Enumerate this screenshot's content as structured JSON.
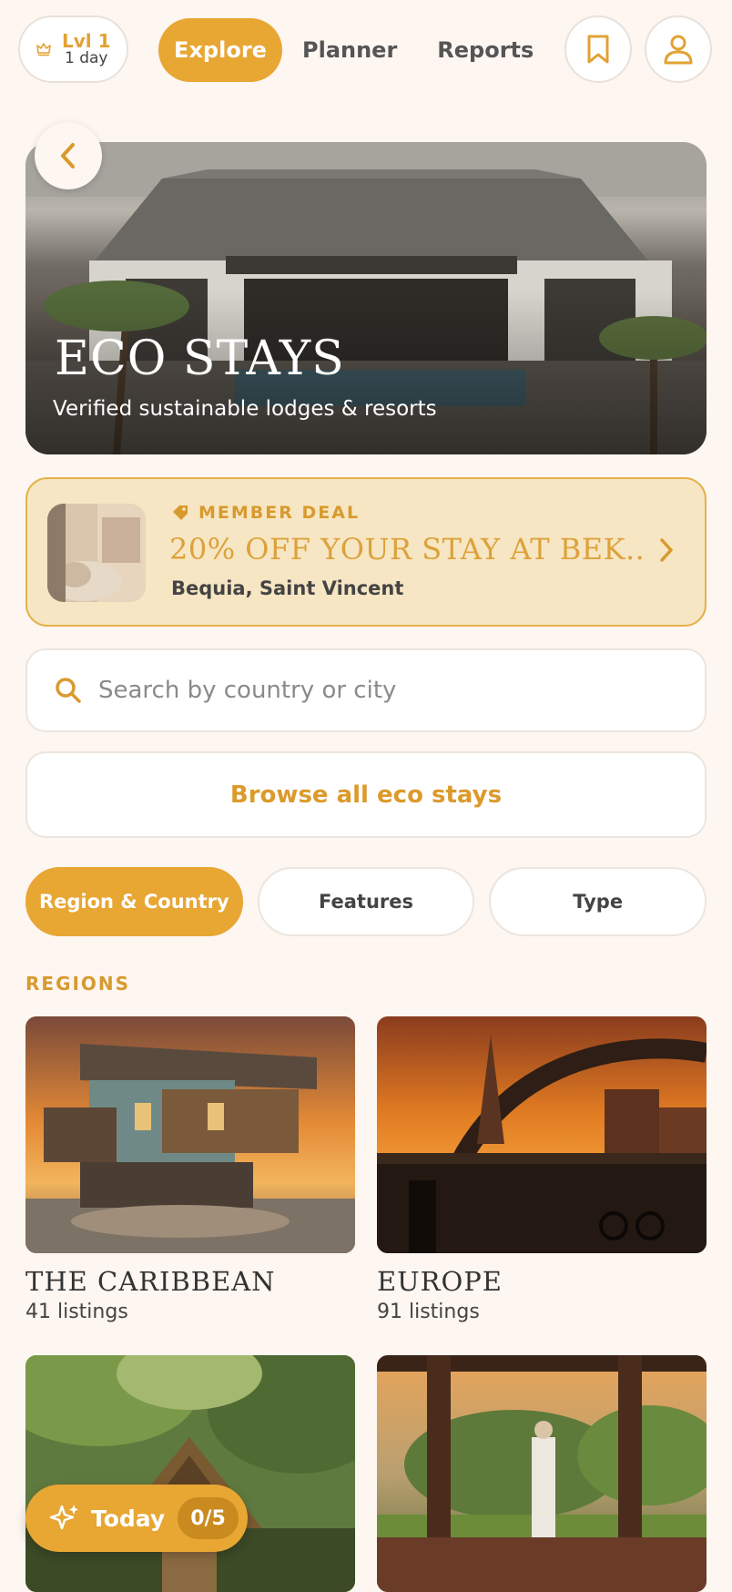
{
  "header": {
    "level": {
      "title": "Lvl 1",
      "subtitle": "1 day"
    },
    "tabs": [
      {
        "label": "Explore",
        "active": true
      },
      {
        "label": "Planner",
        "active": false
      },
      {
        "label": "Reports",
        "active": false
      }
    ]
  },
  "hero": {
    "title": "ECO STAYS",
    "subtitle": "Verified sustainable lodges & resorts"
  },
  "deal": {
    "label": "MEMBER DEAL",
    "title": "20% OFF YOUR STAY AT BEK...",
    "location": "Bequia, Saint Vincent"
  },
  "search": {
    "placeholder": "Search by country or city",
    "value": ""
  },
  "browse_label": "Browse all eco stays",
  "filters": [
    {
      "label": "Region & Country",
      "active": true
    },
    {
      "label": "Features",
      "active": false
    },
    {
      "label": "Type",
      "active": false
    }
  ],
  "regions": {
    "section_label": "REGIONS",
    "items": [
      {
        "name": "THE CARIBBEAN",
        "count": "41 listings"
      },
      {
        "name": "EUROPE",
        "count": "91 listings"
      },
      {
        "name": "",
        "count": ""
      },
      {
        "name": "",
        "count": ""
      }
    ]
  },
  "today": {
    "label": "Today",
    "count": "0/5"
  },
  "colors": {
    "accent": "#e8a633",
    "background": "#fdf6f1",
    "deal_bg": "#f7e6c3"
  }
}
